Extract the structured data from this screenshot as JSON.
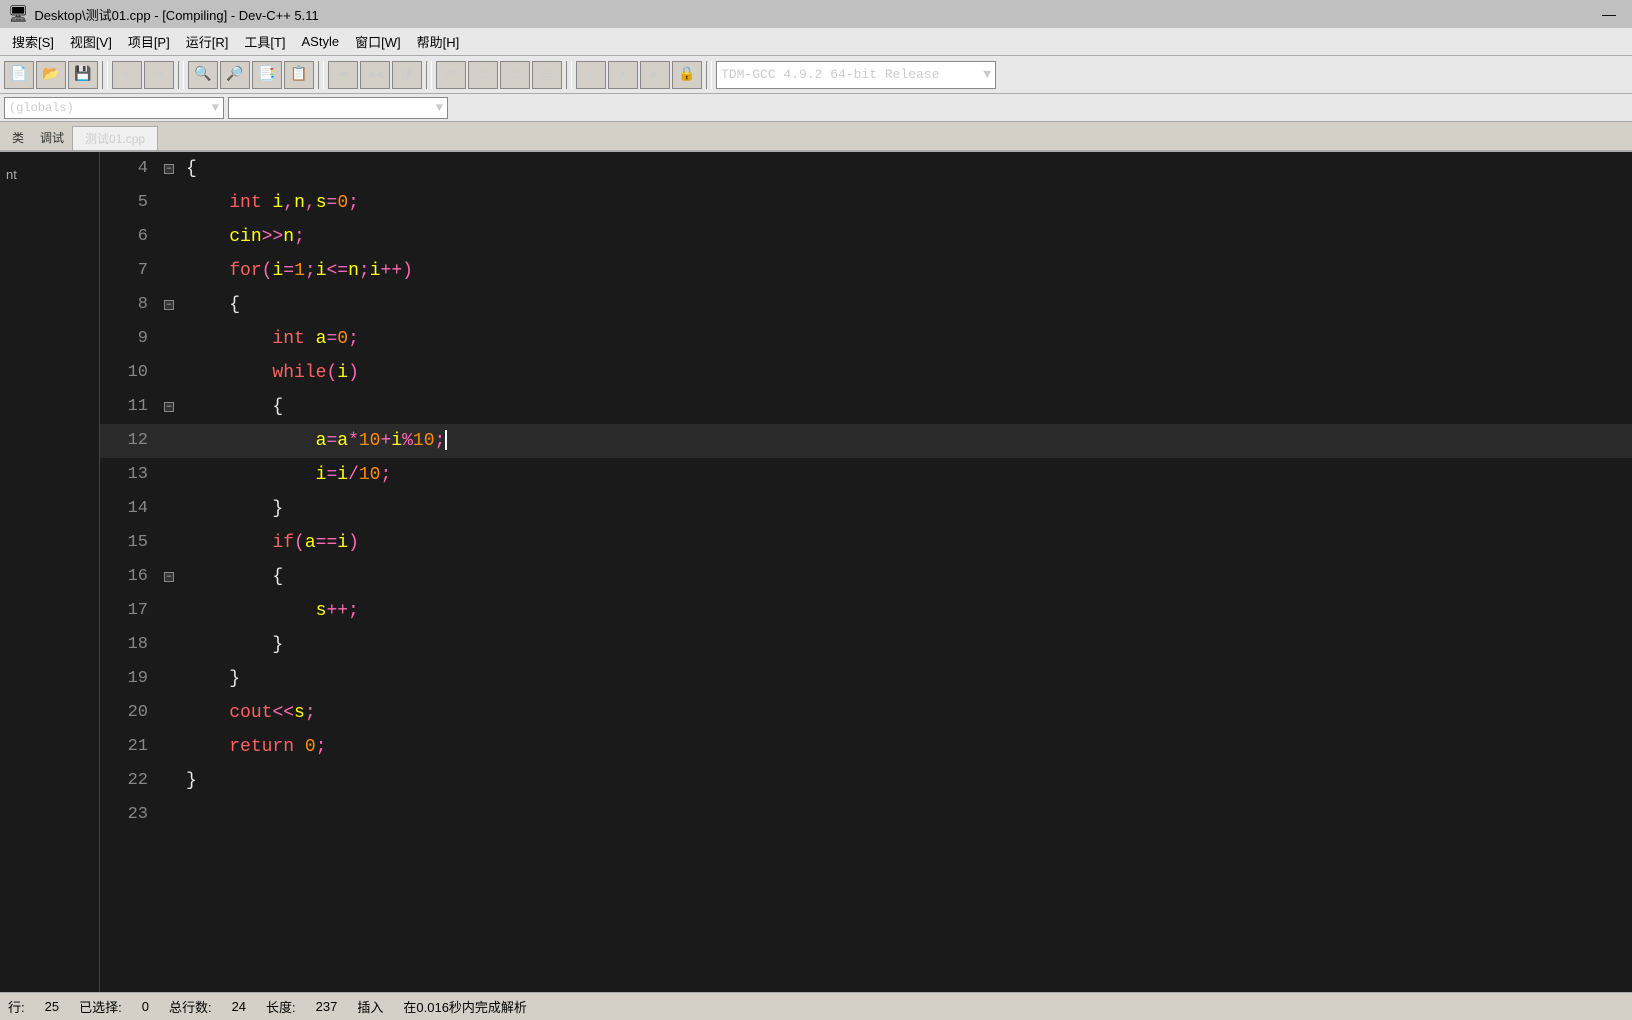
{
  "titlebar": {
    "title": "Desktop\\测试01.cpp - [Compiling] - Dev-C++ 5.11",
    "minimize_label": "—"
  },
  "menubar": {
    "items": [
      {
        "label": "搜索[S]"
      },
      {
        "label": "视图[V]"
      },
      {
        "label": "项目[P]"
      },
      {
        "label": "运行[R]"
      },
      {
        "label": "工具[T]"
      },
      {
        "label": "AStyle"
      },
      {
        "label": "窗口[W]"
      },
      {
        "label": "帮助[H]"
      }
    ]
  },
  "toolbar": {
    "compiler_dropdown": "TDM-GCC 4.9.2 64-bit Release"
  },
  "tabs": {
    "side_labels": [
      "类",
      "调试"
    ],
    "file_tab": "测试01.cpp"
  },
  "scope": {
    "left": "(globals)",
    "right": ""
  },
  "editor": {
    "lines": [
      {
        "num": 4,
        "fold": "■",
        "content_html": "<span class='bracket'>{</span>",
        "active": false
      },
      {
        "num": 5,
        "fold": "",
        "content_html": "    <span class='kw'>int</span> <span class='var'>i</span><span class='punc'>,</span><span class='var'>n</span><span class='punc'>,</span><span class='var'>s</span><span class='op'>=</span><span class='num'>0</span><span class='punc'>;</span>",
        "active": false
      },
      {
        "num": 6,
        "fold": "",
        "content_html": "    <span class='var'>cin</span><span class='op'>>></span><span class='var'>n</span><span class='punc'>;</span>",
        "active": false
      },
      {
        "num": 7,
        "fold": "",
        "content_html": "    <span class='kw'>for</span><span class='punc'>(</span><span class='var'>i</span><span class='op'>=</span><span class='num'>1</span><span class='punc'>;</span><span class='var'>i</span><span class='op'><=</span><span class='var'>n</span><span class='punc'>;</span><span class='var'>i</span><span class='op'>++</span><span class='punc'>)</span>",
        "active": false
      },
      {
        "num": 8,
        "fold": "■",
        "content_html": "    <span class='bracket'>{</span>",
        "active": false
      },
      {
        "num": 9,
        "fold": "",
        "content_html": "        <span class='kw'>int</span> <span class='var'>a</span><span class='op'>=</span><span class='num'>0</span><span class='punc'>;</span>",
        "active": false
      },
      {
        "num": 10,
        "fold": "",
        "content_html": "        <span class='kw'>while</span><span class='punc'>(</span><span class='var'>i</span><span class='punc'>)</span>",
        "active": false
      },
      {
        "num": 11,
        "fold": "■",
        "content_html": "        <span class='bracket'>{</span>",
        "active": false
      },
      {
        "num": 12,
        "fold": "",
        "content_html": "            <span class='var'>a</span><span class='op'>=</span><span class='var'>a</span><span class='op'>*</span><span class='num'>10</span><span class='op'>+</span><span class='var'>i</span><span class='op'>%</span><span class='num'>10</span><span class='punc'>;</span>",
        "active": true
      },
      {
        "num": 13,
        "fold": "",
        "content_html": "            <span class='var'>i</span><span class='op'>=</span><span class='var'>i</span><span class='op'>/</span><span class='num'>10</span><span class='punc'>;</span>",
        "active": false
      },
      {
        "num": 14,
        "fold": "",
        "content_html": "        <span class='bracket'>}</span>",
        "active": false
      },
      {
        "num": 15,
        "fold": "",
        "content_html": "        <span class='kw'>if</span><span class='punc'>(</span><span class='var'>a</span><span class='op'>==</span><span class='var'>i</span><span class='punc'>)</span>",
        "active": false
      },
      {
        "num": 16,
        "fold": "■",
        "content_html": "        <span class='bracket'>{</span>",
        "active": false
      },
      {
        "num": 17,
        "fold": "",
        "content_html": "            <span class='var'>s</span><span class='op'>++</span><span class='punc'>;</span>",
        "active": false
      },
      {
        "num": 18,
        "fold": "",
        "content_html": "        <span class='bracket'>}</span>",
        "active": false
      },
      {
        "num": 19,
        "fold": "",
        "content_html": "    <span class='bracket'>}</span>",
        "active": false
      },
      {
        "num": 20,
        "fold": "",
        "content_html": "    <span class='kw'>cout</span><span class='op'><<</span><span class='var'>s</span><span class='punc'>;</span>",
        "active": false
      },
      {
        "num": 21,
        "fold": "",
        "content_html": "    <span class='kw'>return</span> <span class='num'>0</span><span class='punc'>;</span>",
        "active": false
      },
      {
        "num": 22,
        "fold": "",
        "content_html": "<span class='bracket'>}</span>",
        "active": false
      },
      {
        "num": 23,
        "fold": "",
        "content_html": "",
        "active": false
      }
    ],
    "cursor_line": 12,
    "cursor_visible": true
  },
  "statusbar": {
    "row_label": "行:",
    "row_value": "25",
    "selected_label": "已选择:",
    "selected_value": "0",
    "total_lines_label": "总行数:",
    "total_lines_value": "24",
    "length_label": "长度:",
    "length_value": "237",
    "insert_label": "插入",
    "parse_label": "在0.016秒内完成解析"
  }
}
